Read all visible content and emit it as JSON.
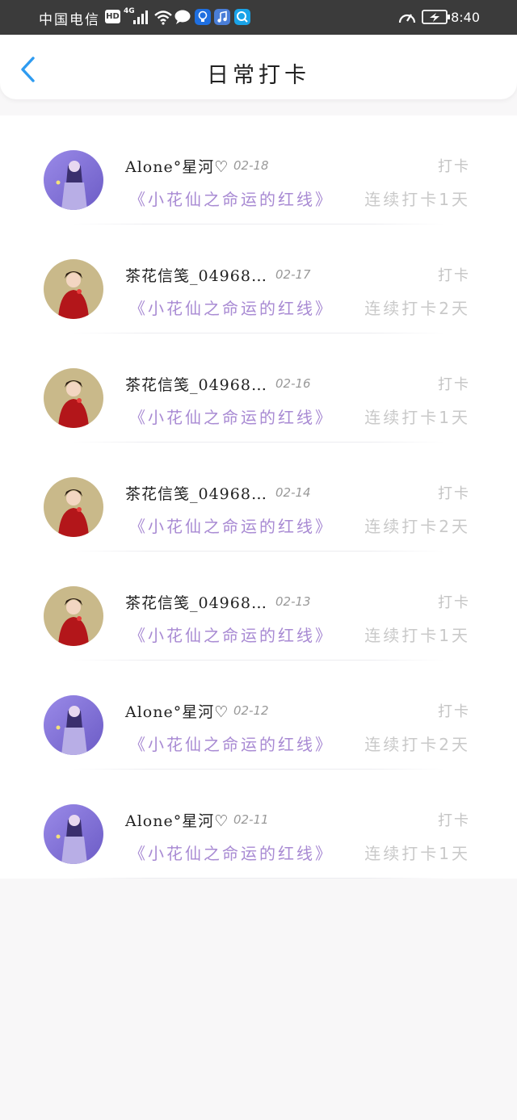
{
  "status_bar": {
    "carrier": "中国电信",
    "hd": "HD",
    "network": "4G",
    "time": "8:40"
  },
  "header": {
    "title": "日常打卡",
    "back_icon": "chevron-left-icon"
  },
  "colors": {
    "accent": "#2e9bf0",
    "book_title": "#a88ad3",
    "muted": "#c9c9c9"
  },
  "entries": [
    {
      "user": "Alone°星河♡",
      "date": "02-18",
      "tag": "打卡",
      "book": "《小花仙之命运的红线》",
      "streak": "连续打卡1天",
      "avatar": "purple"
    },
    {
      "user": "茶花信笺_04968…",
      "date": "02-17",
      "tag": "打卡",
      "book": "《小花仙之命运的红线》",
      "streak": "连续打卡2天",
      "avatar": "red"
    },
    {
      "user": "茶花信笺_04968…",
      "date": "02-16",
      "tag": "打卡",
      "book": "《小花仙之命运的红线》",
      "streak": "连续打卡1天",
      "avatar": "red"
    },
    {
      "user": "茶花信笺_04968…",
      "date": "02-14",
      "tag": "打卡",
      "book": "《小花仙之命运的红线》",
      "streak": "连续打卡2天",
      "avatar": "red"
    },
    {
      "user": "茶花信笺_04968…",
      "date": "02-13",
      "tag": "打卡",
      "book": "《小花仙之命运的红线》",
      "streak": "连续打卡1天",
      "avatar": "red"
    },
    {
      "user": "Alone°星河♡",
      "date": "02-12",
      "tag": "打卡",
      "book": "《小花仙之命运的红线》",
      "streak": "连续打卡2天",
      "avatar": "purple"
    },
    {
      "user": "Alone°星河♡",
      "date": "02-11",
      "tag": "打卡",
      "book": "《小花仙之命运的红线》",
      "streak": "连续打卡1天",
      "avatar": "purple"
    }
  ]
}
